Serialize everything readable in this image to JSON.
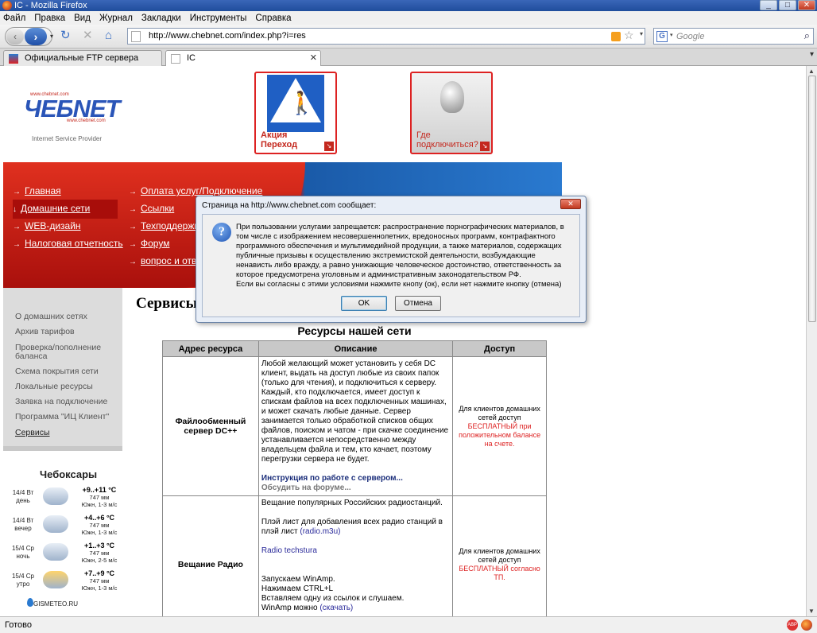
{
  "window": {
    "title": "IC - Mozilla Firefox",
    "min": "_",
    "max": "□",
    "close": "✕"
  },
  "menu": [
    "Файл",
    "Правка",
    "Вид",
    "Журнал",
    "Закладки",
    "Инструменты",
    "Справка"
  ],
  "nav": {
    "back": "‹",
    "forward": "›",
    "dropdown": "▾",
    "reload": "↻",
    "stop": "✕",
    "home": "⌂"
  },
  "url": "http://www.chebnet.com/index.php?i=res",
  "bookmark_star": "☆",
  "search": {
    "engine": "G",
    "placeholder": "Google",
    "go": "⌕"
  },
  "tabs": [
    {
      "label": "Официальные FTP сервера опуст...",
      "close": "✕"
    },
    {
      "label": "IC",
      "close": "✕"
    }
  ],
  "tab_scroll": "▾",
  "statusbar": {
    "text": "Готово",
    "abp": "ABP"
  },
  "site": {
    "logo_top": "www.chebnet.com",
    "logo_text": "ЧЕБNET",
    "logo_bottom": "www.chebnet.com",
    "logo_sub": "Internet Service Provider",
    "banner1": "Акция\nПереход",
    "banner2": "Где\nподключиться?",
    "banner_arrow": "↘",
    "nav_arrow": "→",
    "nav_arrow_sel": "↓",
    "nav_left": [
      "Главная",
      "Домашние сети",
      "WEB-дизайн",
      "Налоговая отчетность"
    ],
    "nav_right": [
      "Оплата услуг/Подключение",
      "Ссылки",
      "Техподдержка",
      "Форум",
      "вопрос и ответ"
    ],
    "sidebar": [
      "О домашних сетях",
      "Архив тарифов",
      "Проверка/пополнение баланса",
      "Схема покрытия сети",
      "Локальные ресурсы",
      "Заявка на подключение",
      "Программа \"ИЦ Клиент\"",
      "Сервисы"
    ],
    "section_title": "Сервисы",
    "weather": {
      "city": "Чебоксары",
      "rows": [
        {
          "day": "14/4 Вт\nдень",
          "temp": "+9..+11 °C",
          "pres": "747 мм\nЮжн, 1-3 м/с"
        },
        {
          "day": "14/4 Вт\nвечер",
          "temp": "+4..+6 °C",
          "pres": "747 мм\nЮжн, 1-3 м/с"
        },
        {
          "day": "15/4 Ср\nночь",
          "temp": "+1..+3 °C",
          "pres": "747 мм\nЮжн, 2-5 м/с"
        },
        {
          "day": "15/4 Ср\nутро",
          "temp": "+7..+9 °C",
          "pres": "747 мм\nЮжн, 1-3 м/с"
        }
      ],
      "source": "GISMETEO.RU"
    }
  },
  "resources": {
    "title": "Ресурсы нашей сети",
    "headers": [
      "Адрес ресурса",
      "Описание",
      "Доступ"
    ],
    "rows": [
      {
        "name": "Файлообменный сервер DC++",
        "desc": "Любой желающий может установить у себя DC клиент, выдать на доступ любые из своих папок (только для чтения), и подключиться к серверу. Каждый, кто подключается, имеет доступ к спискам файлов на всех подключенных машинах, и может скачать любые данные. Сервер занимается только обработкой списков общих файлов, поиском и чатом - при скачке соединение устанавливается непосредственно между владельцем файла и тем, кто качает, поэтому перегрузки сервера не будет.",
        "link1": "Инструкция по работе с сервером...",
        "link2": "Обсудить на форуме...",
        "acc1": "Для клиентов домашних сетей доступ",
        "acc2": "БЕСПЛАТНЫЙ при положительном балансе на счете."
      },
      {
        "name": "Вещание Радио",
        "desc1": "Вещание популярных Российских радиостанций.",
        "desc2": "Плэй лист для добавления всех радио станций в плэй лист",
        "desc2_link": "(radio.m3u)",
        "desc3": "Radio techstura",
        "desc4": "Запускаем WinAmp.",
        "desc5": "Нажимаем CTRL+L",
        "desc6": "Вставляем одну из ссылок и слушаем.",
        "desc7": "WinAmp можно",
        "desc7_link": "(скачать)",
        "acc1": "Для клиентов домашних сетей доступ",
        "acc2": "БЕСПЛАТНЫЙ согласно ТП."
      }
    ]
  },
  "dialog": {
    "title": "Страница на http://www.chebnet.com сообщает:",
    "close": "✕",
    "icon": "?",
    "message": "При пользовании услугами запрещается: распространение порнографических материалов, в том числе с изображением несовершеннолетних, вредоносных программ, контрафактного программного обеспечения и мультимедийной продукции, а также материалов, содержащих публичные призывы к осуществлению экстремистской деятельности, возбуждающие ненависть либо вражду, а равно унижающие человеческое достоинство, ответственность за которое предусмотрена уголовным и административным законодательством РФ.",
    "message2": "Если вы согласны с этими условиями нажмите кнопу (ок), если нет нажмите кнопку (отмена)",
    "ok": "OK",
    "cancel": "Отмена"
  }
}
